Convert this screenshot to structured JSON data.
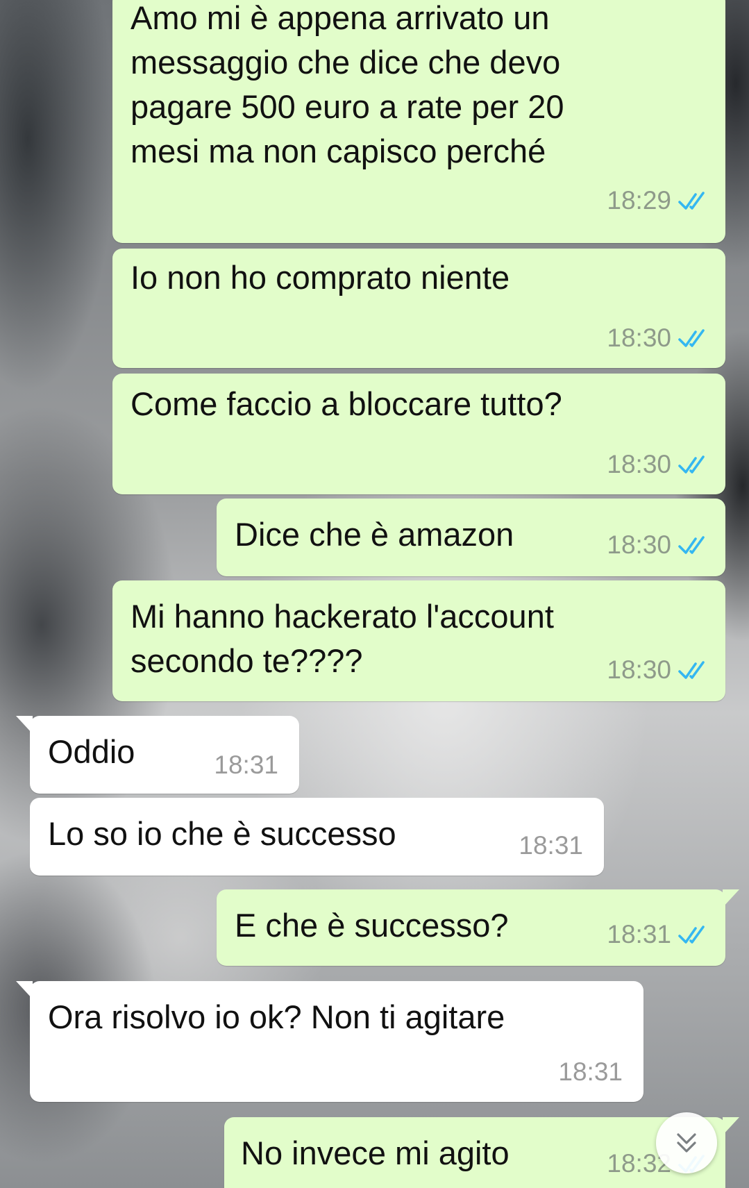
{
  "colors": {
    "outgoing_bubble": "#e2fdca",
    "incoming_bubble": "#ffffff",
    "read_ticks": "#34b7f1"
  },
  "messages": [
    {
      "direction": "outgoing",
      "text": "Amo mi è appena arrivato un\nmessaggio che dice che devo\npagare 500 euro a rate per 20\nmesi ma non capisco perché",
      "time": "18:29",
      "status": "read"
    },
    {
      "direction": "outgoing",
      "text": "Io non ho comprato niente",
      "time": "18:30",
      "status": "read"
    },
    {
      "direction": "outgoing",
      "text": "Come faccio a bloccare tutto?",
      "time": "18:30",
      "status": "read"
    },
    {
      "direction": "outgoing",
      "text": "Dice che è amazon",
      "time": "18:30",
      "status": "read"
    },
    {
      "direction": "outgoing",
      "text": "Mi hanno hackerato l'account\nsecondo te????",
      "time": "18:30",
      "status": "read"
    },
    {
      "direction": "incoming",
      "text": "Oddio",
      "time": "18:31"
    },
    {
      "direction": "incoming",
      "text": "Lo so io che è successo",
      "time": "18:31"
    },
    {
      "direction": "outgoing",
      "text": "E che è successo?",
      "time": "18:31",
      "status": "read"
    },
    {
      "direction": "incoming",
      "text": "Ora risolvo io ok? Non ti agitare",
      "time": "18:31"
    },
    {
      "direction": "outgoing",
      "text": "No invece mi agito",
      "time": "18:32",
      "status": "read"
    }
  ],
  "scroll_button": {
    "icon": "chevrons-down-icon"
  }
}
